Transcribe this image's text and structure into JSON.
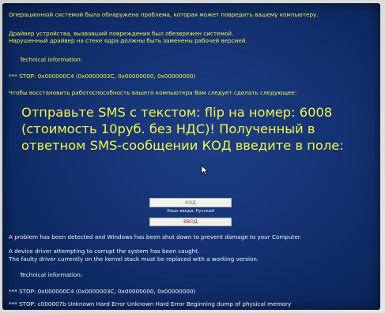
{
  "top": {
    "line1": "Операционной системой была обнаружена проблема, которая может повредить вашему компьютеру.",
    "line2": "Драйвер устройства, вызвавший повреждения был обезврежен системой.",
    "line3": "Нарушенный драйвер на стеке ядра должны быть заменены рабочей версией.",
    "tech_heading": "Technical information:",
    "stop_line": "*** STOP: 0x000000C4 (0x0000003C,  0x00000000, 0x00000000)",
    "restore_line": "Чтобы восстановить работоспособность вашего компьютера Вам следует сделать следующее:"
  },
  "instruction": "Отправьте SMS с текстом: flip на номер: 6008 (стоимость 10руб. без НДС)! Полученный в ответном SMS-сообщении КОД введите в поле:",
  "form": {
    "code_placeholder": "КОД",
    "layout_label": "Язык ввода: Русский",
    "enter_button": "ВВОД"
  },
  "bottom": {
    "line1": "A problem has been detected and Windows has been shut down to prevent damage to your Computer.",
    "line2": "A device driver attempting to corrupt the system has been caught.",
    "line3": "The faulty driver currently on the kernel stack must be replaced with a working version.",
    "tech_heading": "Technical information:",
    "stop_line1": "*** STOP: 0x000000C4 (0x0000003C,  0x00000000, 0x00000000)",
    "stop_line2": "*** STOP: c000007b Unknown Hard Error Unknown Hard Error Beginning dump of physical memory"
  },
  "colors": {
    "background": "#143273",
    "text_yellow": "#f2f246",
    "text_white": "#f4f4f4"
  },
  "icons": {
    "cursor": "arrow-cursor-icon"
  }
}
